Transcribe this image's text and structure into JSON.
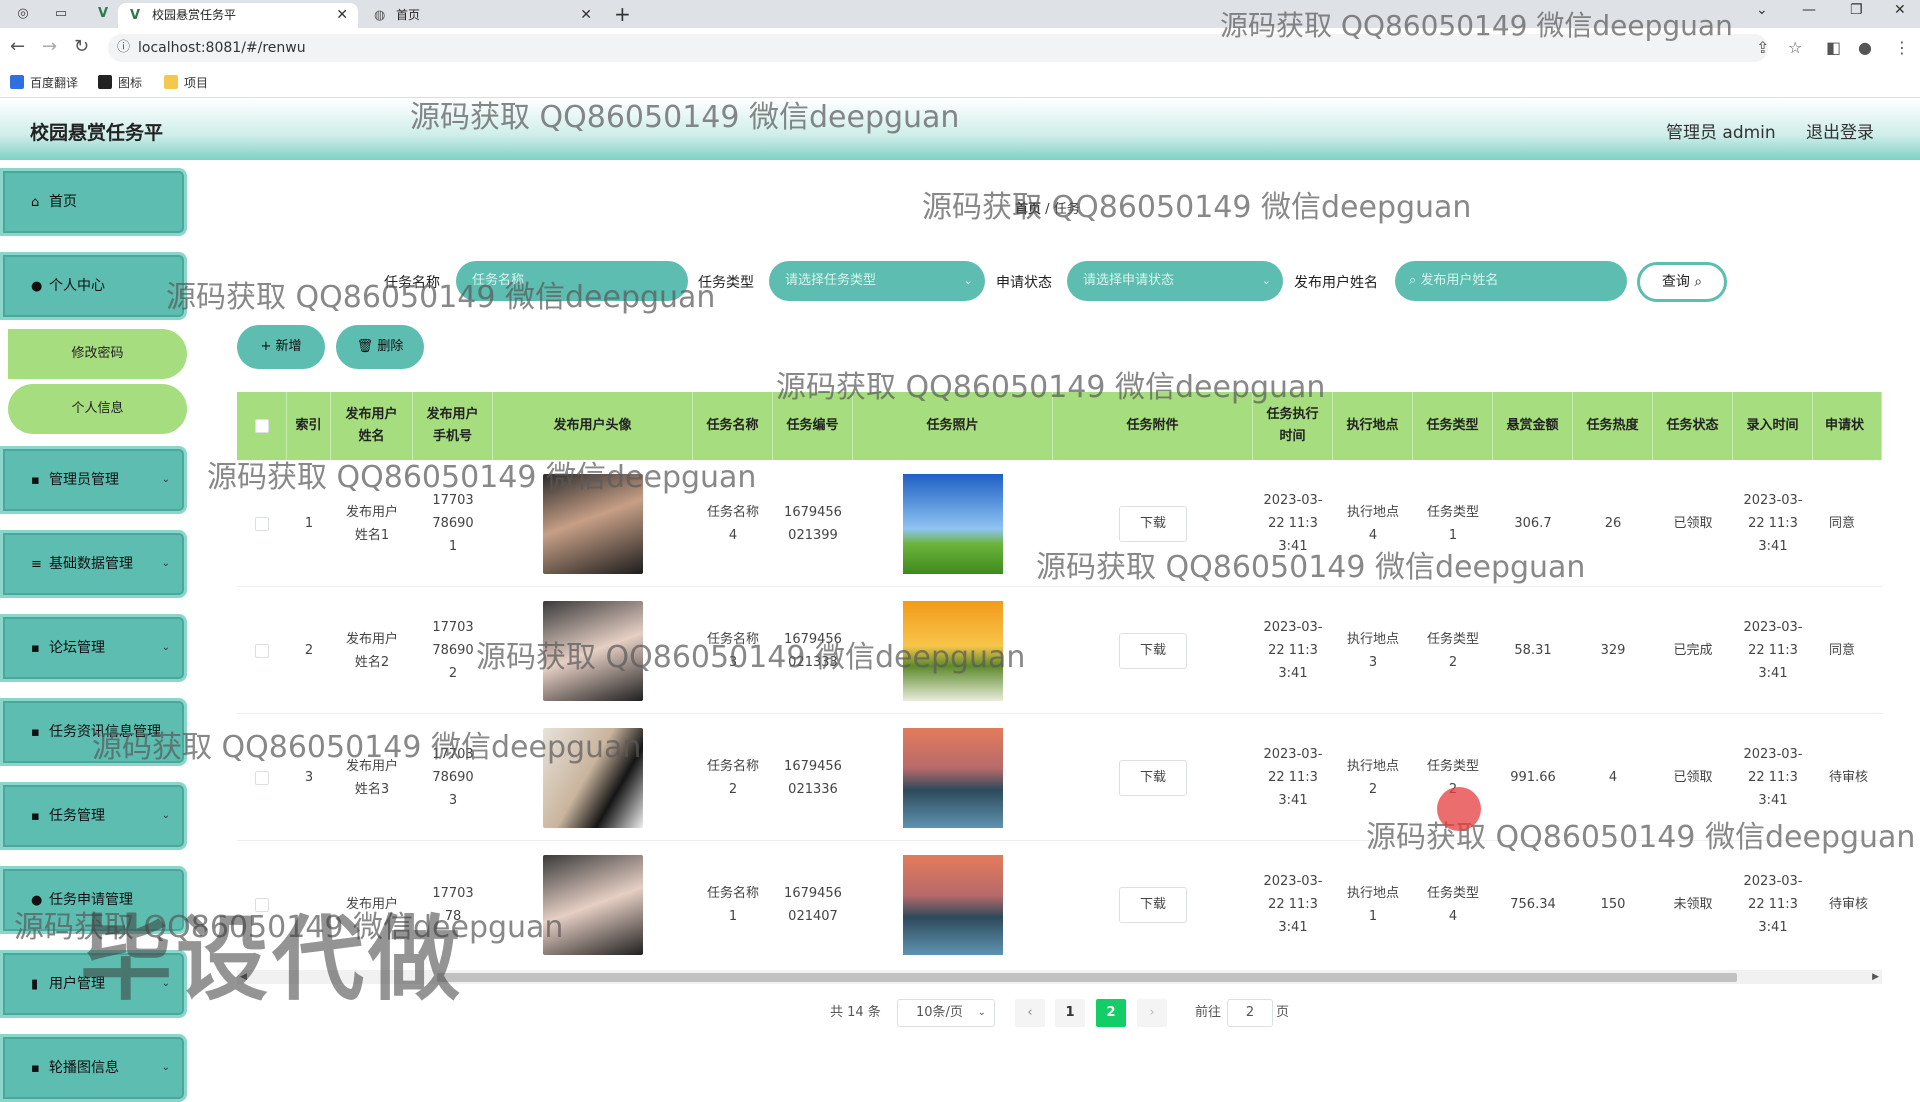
{
  "browser": {
    "tabs": [
      {
        "label": "校园悬赏任务平"
      },
      {
        "label": "首页"
      }
    ],
    "url": "localhost:8081/#/renwu",
    "bookmarks": [
      "百度翻译",
      "图标",
      "项目"
    ]
  },
  "header": {
    "title": "校园悬赏任务平",
    "admin_label": "管理员 admin",
    "logout_label": "退出登录"
  },
  "sidebar": {
    "items": [
      {
        "label": "首页",
        "icon": "home-icon"
      },
      {
        "label": "个人中心",
        "icon": "user-icon"
      },
      {
        "label": "修改密码"
      },
      {
        "label": "个人信息"
      },
      {
        "label": "管理员管理",
        "icon": "grid-icon"
      },
      {
        "label": "基础数据管理",
        "icon": "menu-icon"
      },
      {
        "label": "论坛管理",
        "icon": "grid-icon"
      },
      {
        "label": "任务资讯信息管理",
        "icon": "grid-icon"
      },
      {
        "label": "任务管理",
        "icon": "grid-icon"
      },
      {
        "label": "任务申请管理",
        "icon": "pin-icon"
      },
      {
        "label": "用户管理",
        "icon": "bar-icon"
      },
      {
        "label": "轮播图信息",
        "icon": "grid-icon"
      }
    ]
  },
  "breadcrumb": {
    "home": "首页",
    "sep": "/",
    "current": "任务"
  },
  "filters": {
    "task_name_label": "任务名称",
    "task_name_placeholder": "任务名称",
    "task_type_label": "任务类型",
    "task_type_placeholder": "请选择任务类型",
    "apply_status_label": "申请状态",
    "apply_status_placeholder": "请选择申请状态",
    "publisher_label": "发布用户姓名",
    "publisher_placeholder": "发布用户姓名",
    "query_label": "查询"
  },
  "actions": {
    "add_label": "+ 新增",
    "delete_label": "删除"
  },
  "table": {
    "headers": [
      "索引",
      "发布用户姓名",
      "发布用户手机号",
      "发布用户头像",
      "任务名称",
      "任务编号",
      "任务照片",
      "任务附件",
      "任务执行时间",
      "执行地点",
      "任务类型",
      "悬赏金额",
      "任务热度",
      "任务状态",
      "录入时间",
      "申请状"
    ],
    "download_label": "下载",
    "rows": [
      {
        "index": "1",
        "name": "发布用户姓名1",
        "phone": "17703786901",
        "task": "任务名称4",
        "code": "1679456021399",
        "time": "2023-03-22 11:33:41",
        "place": "执行地点4",
        "type": "任务类型1",
        "amount": "306.7",
        "heat": "26",
        "status": "已领取",
        "created": "2023-03-22 11:33:41",
        "apply": "同意",
        "avatar": "avatar-man",
        "photo": "sky-field"
      },
      {
        "index": "2",
        "name": "发布用户姓名2",
        "phone": "17703786902",
        "task": "任务名称3",
        "code": "1679456021333",
        "time": "2023-03-22 11:33:41",
        "place": "执行地点3",
        "type": "任务类型2",
        "amount": "58.31",
        "heat": "329",
        "status": "已完成",
        "created": "2023-03-22 11:33:41",
        "apply": "同意",
        "avatar": "avatar-woman",
        "photo": "sunset-flowers"
      },
      {
        "index": "3",
        "name": "发布用户姓名3",
        "phone": "17703786903",
        "task": "任务名称2",
        "code": "1679456021336",
        "time": "2023-03-22 11:33:41",
        "place": "执行地点2",
        "type": "任务类型2",
        "amount": "991.66",
        "heat": "4",
        "status": "已领取",
        "created": "2023-03-22 11:33:41",
        "apply": "待审核",
        "avatar": "avatar-back",
        "photo": "lake-dusk"
      },
      {
        "index": "",
        "name": "发布用户",
        "phone": "1770378",
        "task": "任务名称1",
        "code": "1679456021407",
        "time": "2023-03-22 11:33:41",
        "place": "执行地点1",
        "type": "任务类型4",
        "amount": "756.34",
        "heat": "150",
        "status": "未领取",
        "created": "2023-03-22 11:33:41",
        "apply": "待审核",
        "avatar": "avatar-woman",
        "photo": "lake-dusk"
      }
    ]
  },
  "pagination": {
    "total": "共 14 条",
    "page_size": "10条/页",
    "pages": [
      "1",
      "2"
    ],
    "goto_label": "前往",
    "goto_value": "2",
    "page_suffix": "页"
  },
  "watermarks": {
    "text": "源码获取 QQ86050149 微信deepguan",
    "big": "毕设代做"
  },
  "colors": {
    "teal": "#5cbdb0",
    "green_header": "#a6dd7e",
    "active_page": "#13ce66"
  }
}
